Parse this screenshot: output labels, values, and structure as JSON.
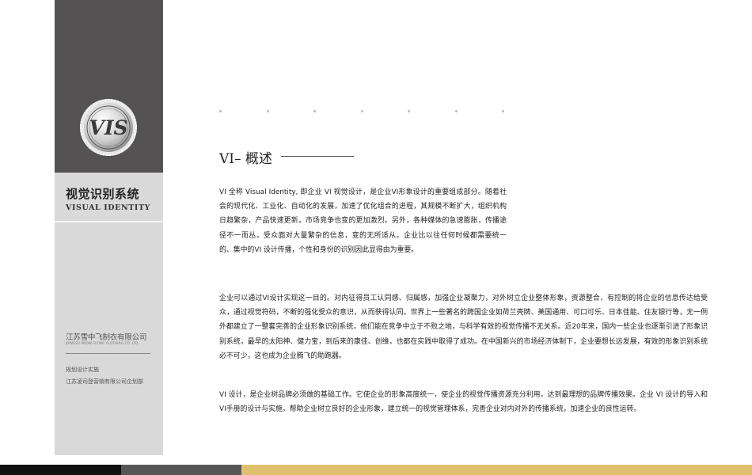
{
  "sidebar": {
    "logo_text": "VIS",
    "brand_cn": "视觉识别系统",
    "brand_en": "VISUAL IDENTITY",
    "company_cn": "江苏雪中飞制衣有限公司",
    "company_en": "JIANGSU SNOW FLYING CLOTHING CO. LTD.",
    "plan_label": "规划设计实施",
    "plan_company": "江苏凌司登营销有限公司企划部"
  },
  "content": {
    "title": "VI– 概述",
    "paragraphs": [
      "VI 全称 Visual Identity, 即企业 VI 视觉设计，是企业VI形象设计的重要组成部分。随着社会的现代化、工业化、自动化的发展，加速了优化组合的进程，其规模不断扩大，组织机构日趋繁杂，产品快速更新，市场竞争也变的更加激烈。另外，各种媒体的急速膨胀，传播途径不一而丛，受众面对大量繁杂的信息，变的无所适从。企业比以往任何时候都需要统一的、集中的VI 设计传播，个性和身份的识别因此显得由为重要。",
      "企业可以通过VI设计实现这一目的。对内征得员工认同感、归属感，加强企业凝聚力，对外树立企业整体形象，资源整合，有控制的将企业的信息传达给受众，通过视觉符码，不断的强化受众的意识，从而获得认同。世界上一些著名的跨国企业如荷兰壳牌、美国通用、可口可乐、日本佳能、住友银行等，无一例外都建立了一整套完善的企业形象识别系统，他们能在竞争中立于不败之地，与科学有效的视觉传播不无关系。近20年来，国内一些企业也逐渐引进了形象识别系统，最早的太阳神、健力宝，到后来的康佳、创维，也都在实践中取得了成功。在中国新兴的市场经济体制下，企业要想长远发展，有效的形象识别系统必不可少，这也成为企业腾飞的助跑器。",
      "VI 设计，是企业树品牌必须做的基础工作。它使企业的形象高度统一，使企业的视觉传播资源充分利用，达到最理想的品牌传播效果。企业 VI 设计的导入和VI手册的设计与实施，帮助企业树立良好的企业形象，建立统一的视觉管理体系，完善企业对内对外的传播系统，加速企业的良性运转。"
    ]
  },
  "colors": {
    "sidebar_dark": "#545253",
    "sidebar_light": "#d9d9d9",
    "bar_black": "#111111",
    "bar_gray": "#575657",
    "bar_gold": "#e0c06e"
  }
}
